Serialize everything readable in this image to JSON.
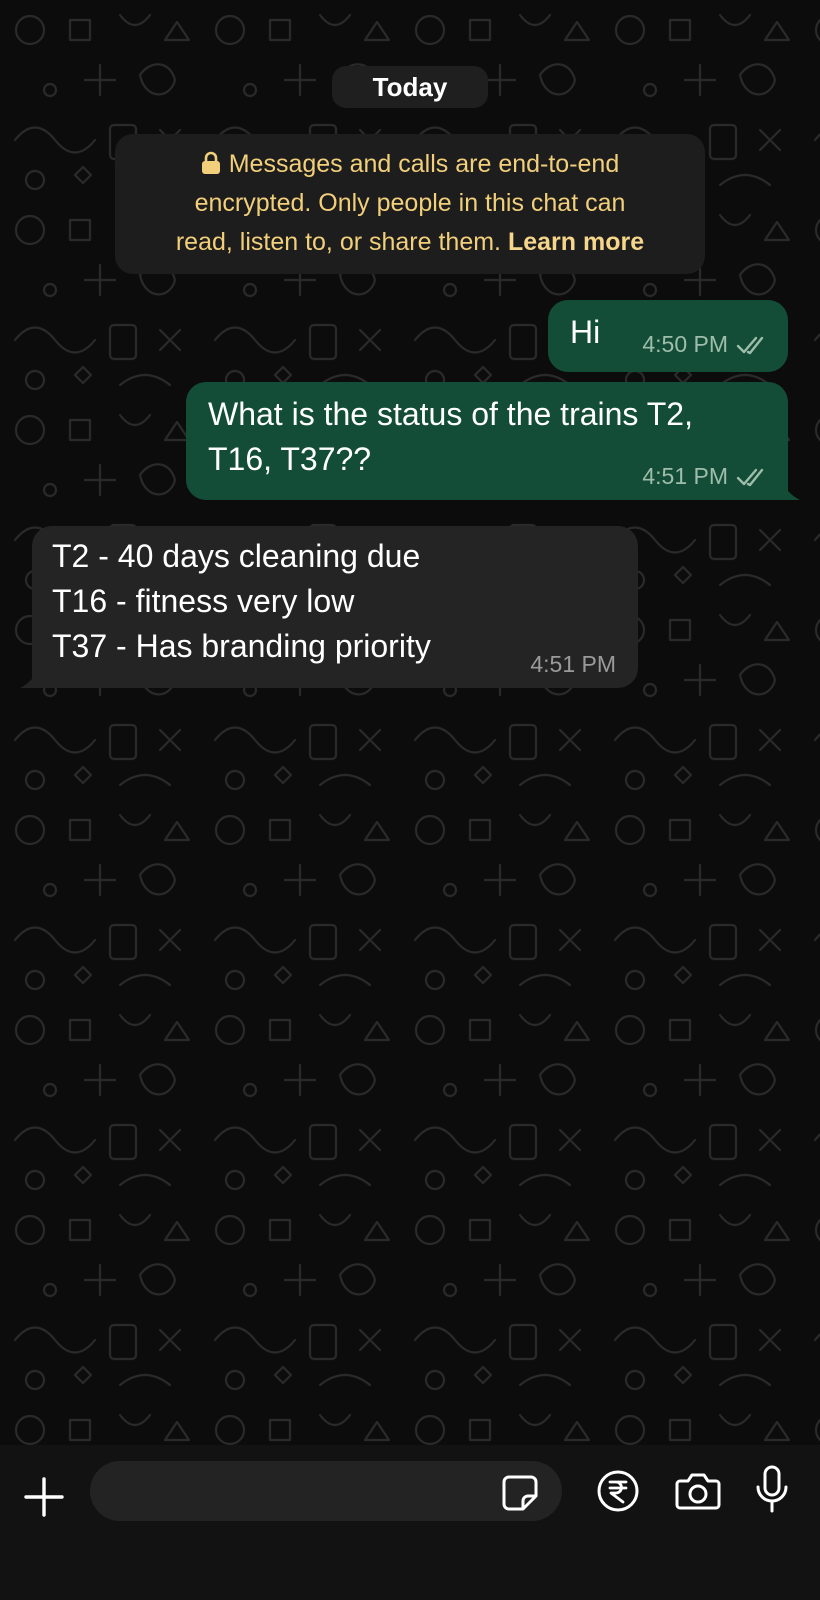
{
  "chat": {
    "date_label": "Today",
    "encryption_notice": {
      "text_line1": "Messages and calls are end-to-end",
      "text_line2": "encrypted. Only people in this chat can",
      "text_line3": "read, listen to, or share them.",
      "link_label": "Learn more"
    },
    "messages": [
      {
        "direction": "outgoing",
        "text": "Hi",
        "time": "4:50 PM",
        "status": "delivered"
      },
      {
        "direction": "outgoing",
        "text": "What is the status of the trains T2,\nT16, T37??",
        "time": "4:51 PM",
        "status": "delivered"
      },
      {
        "direction": "incoming",
        "text": "T2 - 40 days cleaning due\nT16 - fitness very low\nT37 - Has branding priority",
        "time": "4:51 PM"
      }
    ]
  },
  "composer": {
    "input_value": "",
    "placeholder": "",
    "icons": [
      "plus-icon",
      "sticker-icon",
      "rupee-payment-icon",
      "camera-icon",
      "microphone-icon"
    ]
  },
  "colors": {
    "background": "#0c0c0c",
    "outgoing_bubble": "#134d37",
    "incoming_bubble": "#242424",
    "encryption_text": "#f2cf7a",
    "composer_bar": "#121212"
  }
}
